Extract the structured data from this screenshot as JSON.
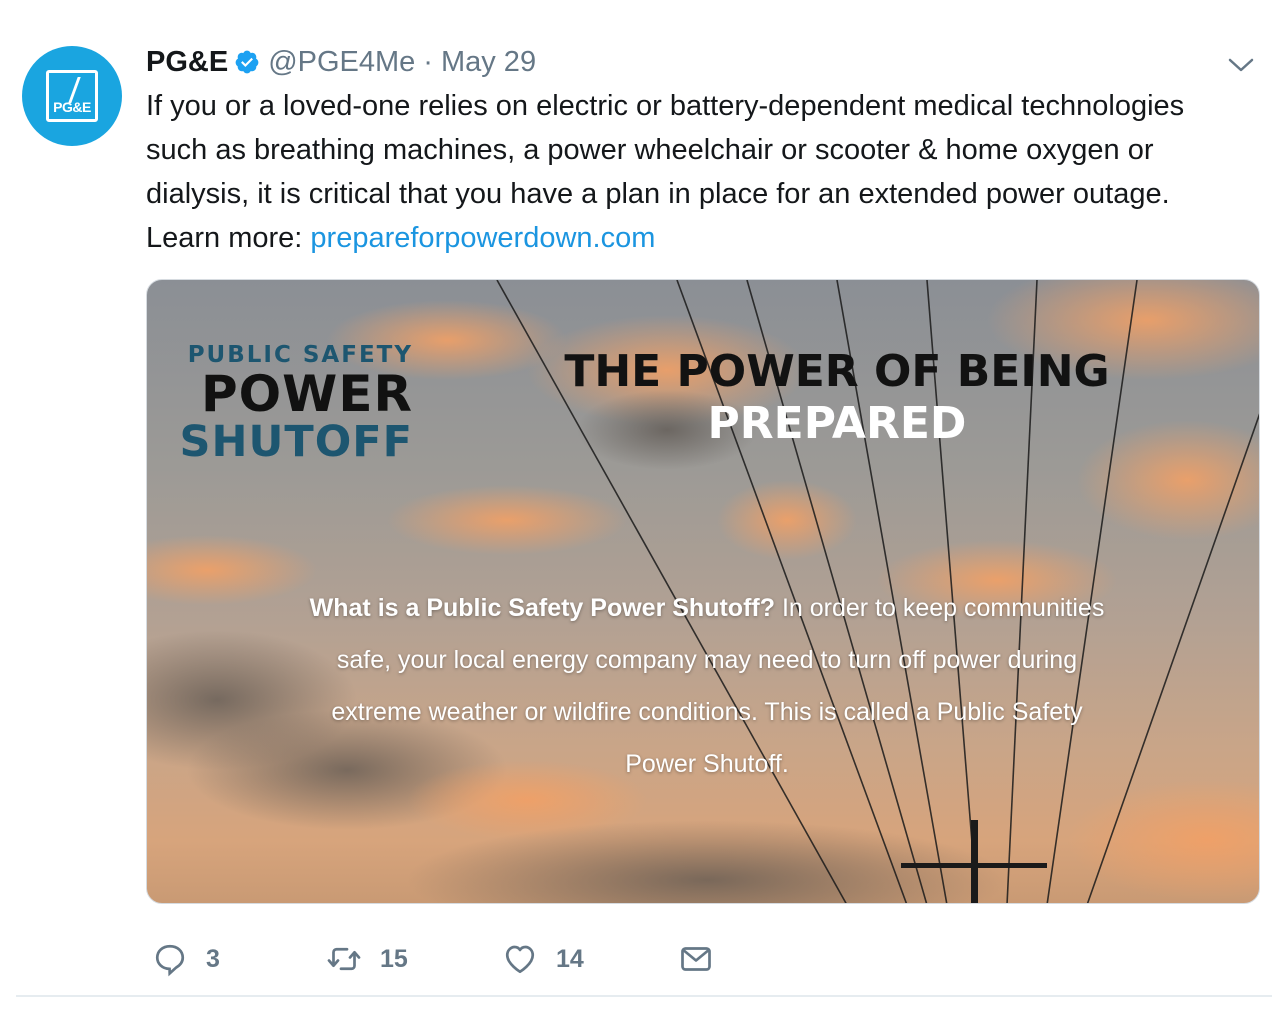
{
  "tweet": {
    "author_name": "PG&E",
    "handle": "@PGE4Me",
    "separator": "·",
    "date": "May 29",
    "avatar_text": "PG&E",
    "verified_icon": "verified-badge-icon",
    "text_lines": [
      "If you or a loved-one relies on electric or battery-dependent medical technologies",
      "such as breathing machines, a power wheelchair or scooter & home oxygen or",
      "dialysis, it is critical that you have a plan in place for an extended power outage."
    ],
    "learn_more_prefix": "Learn more: ",
    "link_text": "prepareforpowerdown.com"
  },
  "media": {
    "pss_line1": "PUBLIC SAFETY",
    "pss_line2": "POWER",
    "pss_line3": "SHUTOFF",
    "headline_line1": "THE POWER OF BEING",
    "headline_line2": "PREPARED",
    "body_bold": "What is a Public Safety Power Shutoff?",
    "body_line1_rest": " In order to keep communities",
    "body_line2": "safe, your local energy company may need to turn off power during",
    "body_line3": "extreme weather or wildfire conditions. This is called a Public Safety",
    "body_line4": "Power Shutoff."
  },
  "actions": {
    "reply_count": "3",
    "retweet_count": "15",
    "like_count": "14"
  },
  "colors": {
    "link": "#1b95e0",
    "muted": "#657786",
    "avatar_bg": "#1aa5e0",
    "verified": "#1da1f2",
    "pss_teal": "#1d5670"
  }
}
